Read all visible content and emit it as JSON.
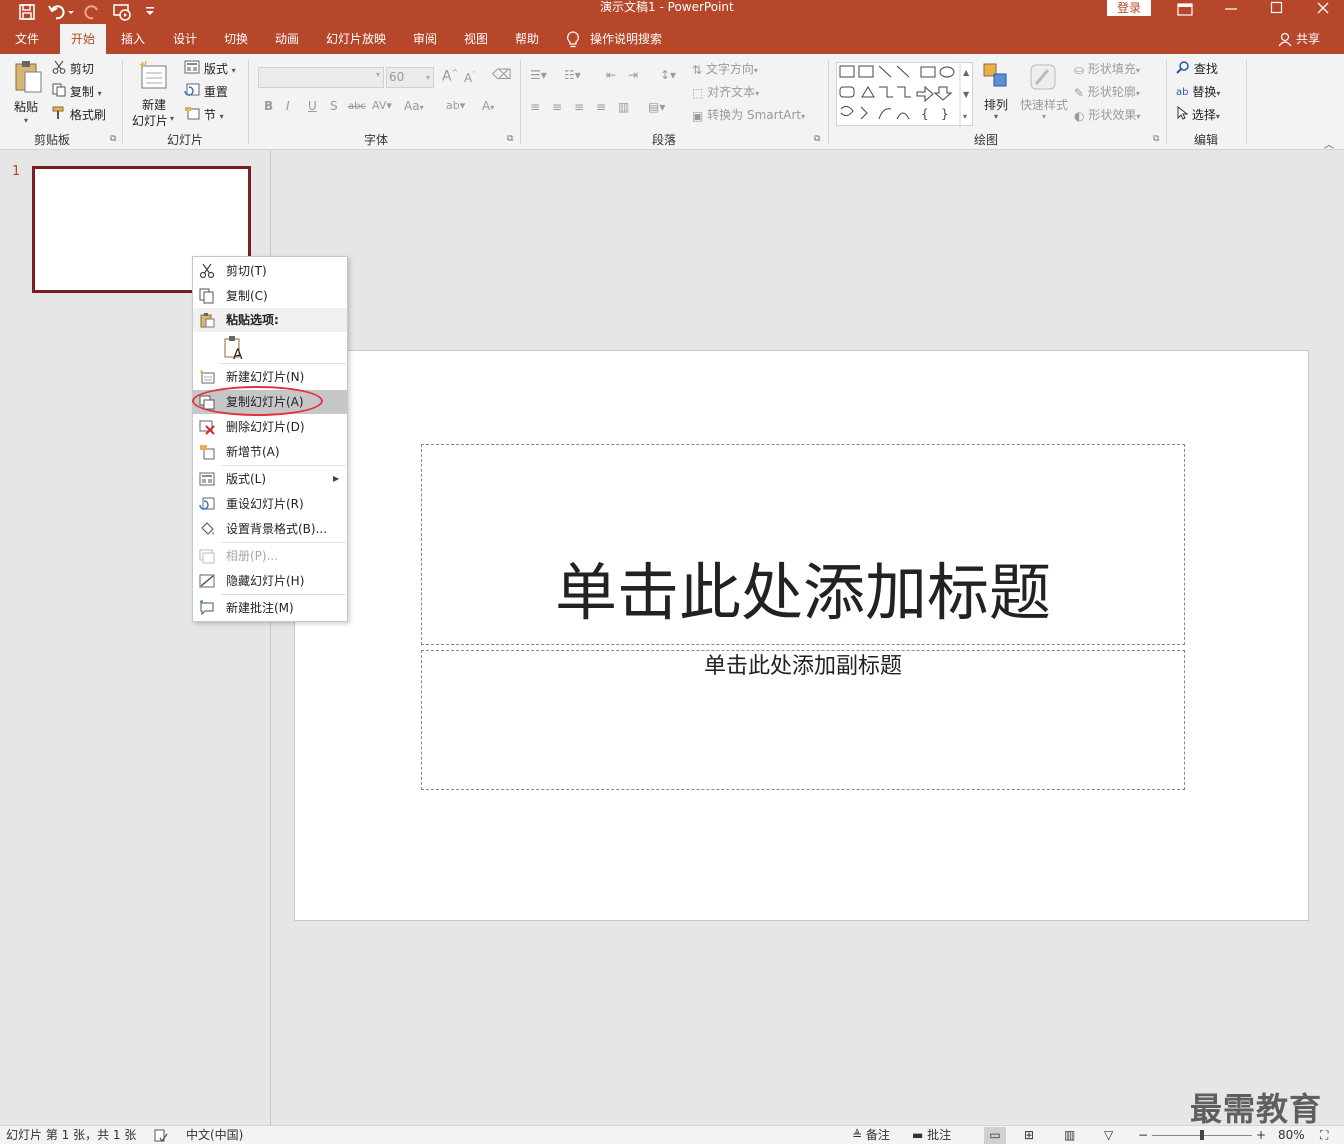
{
  "title_bar": {
    "doc_title": "演示文稿1",
    "separator": "-",
    "app_name": "PowerPoint",
    "login_label": "登录",
    "window_buttons": [
      "restore-ribbon-icon",
      "minimize-icon",
      "maximize-icon",
      "close-icon"
    ]
  },
  "tabs": {
    "file": "文件",
    "home": "开始",
    "insert": "插入",
    "design": "设计",
    "transitions": "切换",
    "animations": "动画",
    "slideshow": "幻灯片放映",
    "review": "审阅",
    "view": "视图",
    "help": "帮助",
    "tell_me": "操作说明搜索",
    "share": "共享"
  },
  "ribbon": {
    "clipboard": {
      "paste": "粘贴",
      "cut": "剪切",
      "copy": "复制",
      "format_painter": "格式刷",
      "group": "剪贴板"
    },
    "slides": {
      "new_slide_line1": "新建",
      "new_slide_line2": "幻灯片",
      "layout": "版式",
      "reset": "重置",
      "section": "节",
      "group": "幻灯片"
    },
    "font": {
      "font_size": "60",
      "group": "字体",
      "case_btn": "Aa"
    },
    "paragraph": {
      "text_direction": "文字方向",
      "align_text": "对齐文本",
      "smartart": "转换为 SmartArt",
      "group": "段落"
    },
    "drawing": {
      "arrange": "排列",
      "quick_styles": "快速样式",
      "shape_fill": "形状填充",
      "shape_outline": "形状轮廓",
      "shape_effects": "形状效果",
      "group": "绘图"
    },
    "editing": {
      "find": "查找",
      "replace": "替换",
      "select": "选择",
      "group": "编辑"
    }
  },
  "thumbnail": {
    "number": "1"
  },
  "context_menu": {
    "cut": "剪切(T)",
    "copy": "复制(C)",
    "paste_options": "粘贴选项:",
    "new_slide": "新建幻灯片(N)",
    "duplicate_slide": "复制幻灯片(A)",
    "delete_slide": "删除幻灯片(D)",
    "add_section": "新增节(A)",
    "layout": "版式(L)",
    "reset_slide": "重设幻灯片(R)",
    "format_background": "设置背景格式(B)...",
    "photo_album": "相册(P)...",
    "hide_slide": "隐藏幻灯片(H)",
    "new_comment": "新建批注(M)"
  },
  "slide": {
    "title_placeholder": "单击此处添加标题",
    "subtitle_placeholder": "单击此处添加副标题"
  },
  "status_bar": {
    "slide_info": "幻灯片 第 1 张，共 1 张",
    "language": "中文(中国)",
    "notes": "备注",
    "comments": "批注",
    "zoom_minus": "−",
    "zoom_plus": "+",
    "zoom": "80%",
    "zoom_fraction": 0.5
  },
  "watermark": "最需教育",
  "colors": {
    "accent": "#b7472a",
    "highlight_ring": "#e0343a",
    "thumb_border": "#7a1f1f"
  }
}
